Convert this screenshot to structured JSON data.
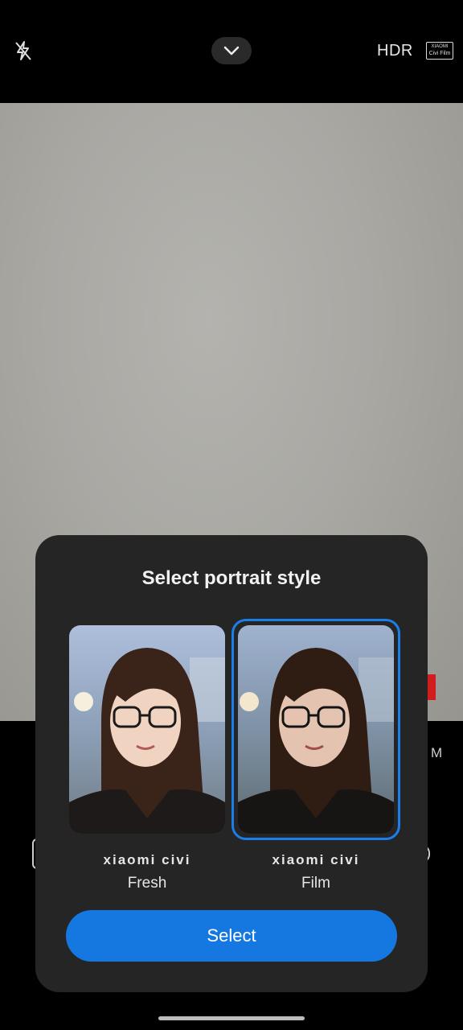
{
  "topbar": {
    "flash_icon": "flash-off-icon",
    "collapse_icon": "chevron-down-icon",
    "hdr_label": "HDR",
    "civi_film_badge": {
      "line1": "XIAOMI",
      "line2": "Civi Film"
    }
  },
  "background": {
    "mode_peek_text": "M"
  },
  "sheet": {
    "title": "Select portrait style",
    "options": [
      {
        "brand": "xiaomi civi",
        "label": "Fresh",
        "selected": false
      },
      {
        "brand": "xiaomi civi",
        "label": "Film",
        "selected": true
      }
    ],
    "select_button": "Select"
  },
  "colors": {
    "accent": "#1577e0",
    "sheet_bg": "#252525",
    "selection_ring": "#1a7fe8"
  }
}
